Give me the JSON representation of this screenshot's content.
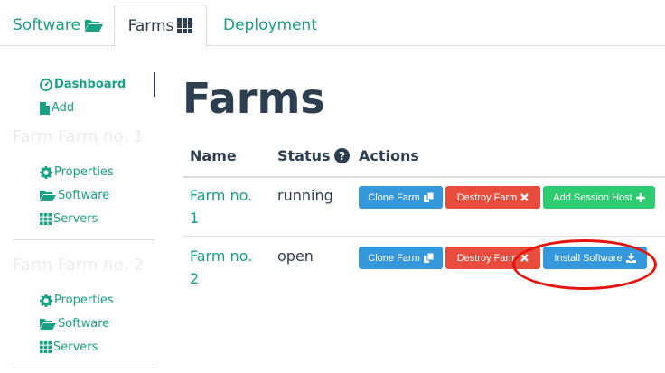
{
  "tabs": [
    {
      "label": "Software",
      "icon": "folder-open-icon",
      "active": false
    },
    {
      "label": "Farms",
      "icon": "grid-icon",
      "active": true
    },
    {
      "label": "Deployment",
      "icon": "",
      "active": false
    }
  ],
  "sidebar": {
    "dashboard_label": "Dashboard",
    "add_label": "Add",
    "farms": [
      {
        "heading": "Farm Farm no. 1",
        "properties_label": "Properties",
        "software_label": "Software",
        "servers_label": "Servers"
      },
      {
        "heading": "Farm Farm no. 2",
        "properties_label": "Properties",
        "software_label": "Software",
        "servers_label": "Servers"
      }
    ]
  },
  "main": {
    "title": "Farms",
    "columns": {
      "name": "Name",
      "status": "Status",
      "actions": "Actions"
    },
    "rows": [
      {
        "name": "Farm no. 1",
        "status": "running",
        "clone_label": "Clone Farm",
        "destroy_label": "Destroy Farm",
        "extra_label": "Add Session Host",
        "extra_icon": "plus-icon"
      },
      {
        "name": "Farm no. 2",
        "status": "open",
        "clone_label": "Clone Farm",
        "destroy_label": "Destroy Farm",
        "extra_label": "Install Software",
        "extra_icon": "download-icon"
      }
    ]
  },
  "colors": {
    "accent": "#18a085",
    "text": "#2c3e50",
    "blue": "#3498db",
    "red": "#e74c3c",
    "green": "#2ecc71",
    "annotation": "#e8120c"
  }
}
